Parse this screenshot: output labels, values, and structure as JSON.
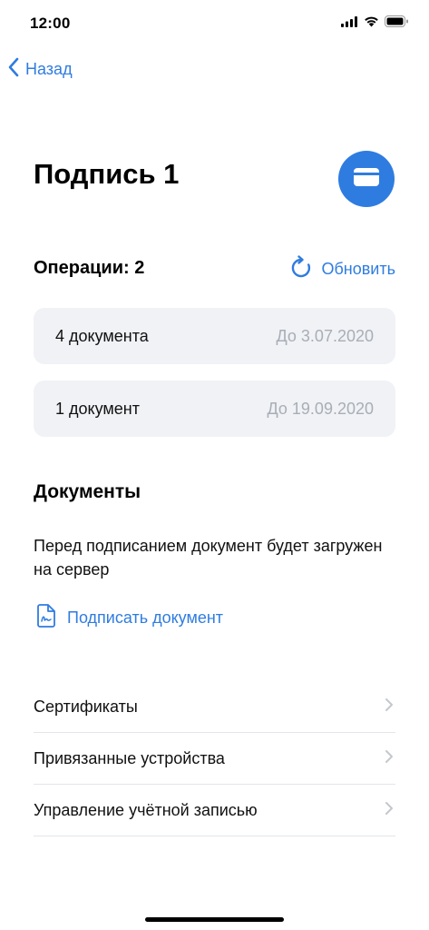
{
  "status_bar": {
    "time": "12:00"
  },
  "nav": {
    "back_label": "Назад"
  },
  "header": {
    "title": "Подпись 1"
  },
  "operations": {
    "title": "Операции: 2",
    "refresh_label": "Обновить",
    "items": [
      {
        "name": "4 документа",
        "date": "До 3.07.2020"
      },
      {
        "name": "1 документ",
        "date": "До 19.09.2020"
      }
    ]
  },
  "documents": {
    "title": "Документы",
    "description": "Перед подписанием документ будет загружен на сервер",
    "sign_label": "Подписать документ"
  },
  "menu": {
    "items": [
      {
        "label": "Сертификаты"
      },
      {
        "label": "Привязанные устройства"
      },
      {
        "label": "Управление учётной записью"
      }
    ]
  },
  "colors": {
    "accent": "#2f7ce0",
    "card_bg": "#f0f2f6",
    "muted_text": "#a9aeb6"
  }
}
